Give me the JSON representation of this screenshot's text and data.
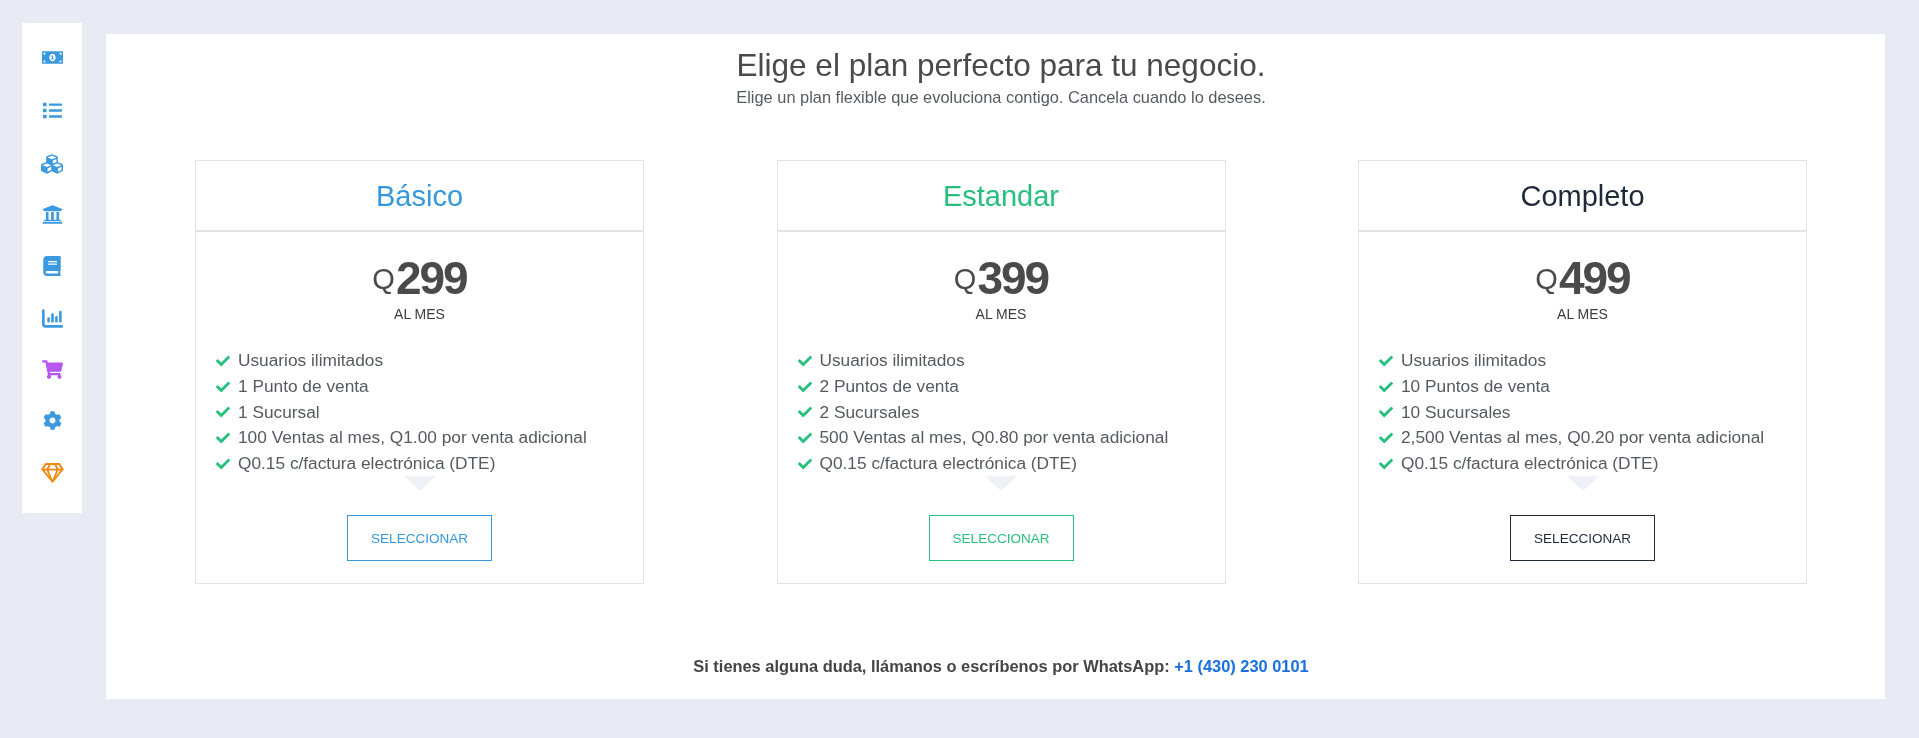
{
  "sidebar": {
    "items": [
      {
        "color": "#3b99e0"
      },
      {
        "color": "#3b99e0"
      },
      {
        "color": "#3b99e0"
      },
      {
        "color": "#3b99e0"
      },
      {
        "color": "#3b99e0"
      },
      {
        "color": "#3b99e0"
      },
      {
        "color": "#b657f2"
      },
      {
        "color": "#3b99e0"
      },
      {
        "color": "#f0890f"
      }
    ]
  },
  "heading": {
    "title": "Elige el plan perfecto para tu negocio.",
    "subtitle": "Elige un plan flexible que evoluciona contigo. Cancela cuando lo desees."
  },
  "plans": [
    {
      "name": "Básico",
      "color": "#3498db",
      "currency": "Q",
      "amount": "299",
      "period": "AL MES",
      "features": [
        "Usuarios ilimitados",
        "1 Punto de venta",
        "1 Sucursal",
        "100 Ventas al mes, Q1.00 por venta adicional",
        "Q0.15 c/factura electrónica (DTE)"
      ],
      "button": "SELECCIONAR"
    },
    {
      "name": "Estandar",
      "color": "#27bf7d",
      "currency": "Q",
      "amount": "399",
      "period": "AL MES",
      "features": [
        "Usuarios ilimitados",
        "2 Puntos de venta",
        "2 Sucursales",
        "500 Ventas al mes, Q0.80 por venta adicional",
        "Q0.15 c/factura electrónica (DTE)"
      ],
      "button": "SELECCIONAR"
    },
    {
      "name": "Completo",
      "color": "#1e2a38",
      "currency": "Q",
      "amount": "499",
      "period": "AL MES",
      "features": [
        "Usuarios ilimitados",
        "10 Puntos de venta",
        "10 Sucursales",
        "2,500 Ventas al mes, Q0.20 por venta adicional",
        "Q0.15 c/factura electrónica (DTE)"
      ],
      "button": "SELECCIONAR"
    }
  ],
  "footer": {
    "text": "Si tienes alguna duda, llámanos o escríbenos por WhatsApp:",
    "link": "+1 (430) 230 0101"
  }
}
